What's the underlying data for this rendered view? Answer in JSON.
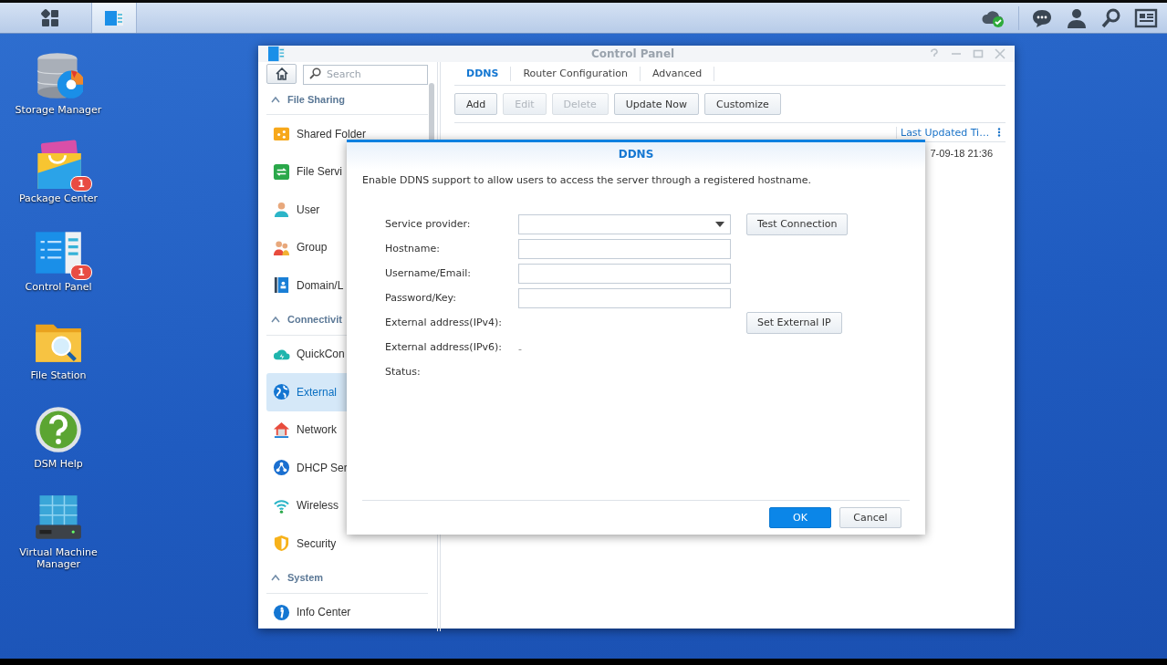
{
  "taskbar": {
    "apps": [
      {
        "kind": "main-menu",
        "selected": false
      },
      {
        "kind": "control-panel",
        "selected": true
      }
    ]
  },
  "desktop_icons": [
    {
      "kind": "storage",
      "label": "Storage Manager"
    },
    {
      "kind": "package",
      "label": "Package Center",
      "badge": "1"
    },
    {
      "kind": "control-panel",
      "label": "Control Panel",
      "badge": "1"
    },
    {
      "kind": "file-station",
      "label": "File Station"
    },
    {
      "kind": "help",
      "label": "DSM Help"
    },
    {
      "kind": "vm",
      "label": "Virtual Machine Manager"
    }
  ],
  "window": {
    "title": "Control Panel"
  },
  "sidebar": {
    "search": {
      "placeholder": "Search"
    },
    "sections": [
      {
        "title": "File Sharing",
        "expanded": true,
        "items": [
          {
            "kind": "shared-folder",
            "label": "Shared Folder",
            "selected": false
          },
          {
            "kind": "file-services",
            "label": "File Servi",
            "selected": false
          },
          {
            "kind": "user",
            "label": "User",
            "selected": false
          },
          {
            "kind": "group",
            "label": "Group",
            "selected": false
          },
          {
            "kind": "domain",
            "label": "Domain/L",
            "selected": false
          }
        ]
      },
      {
        "title": "Connectivit",
        "expanded": true,
        "items": [
          {
            "kind": "quickconnect",
            "label": "QuickCon",
            "selected": false
          },
          {
            "kind": "external",
            "label": "External",
            "selected": true
          },
          {
            "kind": "network",
            "label": "Network",
            "selected": false
          },
          {
            "kind": "dhcp",
            "label": "DHCP Ser",
            "selected": false
          },
          {
            "kind": "wireless",
            "label": "Wireless",
            "selected": false
          },
          {
            "kind": "security",
            "label": "Security",
            "selected": false
          }
        ]
      },
      {
        "title": "System",
        "expanded": true,
        "items": [
          {
            "kind": "info",
            "label": "Info Center",
            "selected": false
          }
        ]
      }
    ]
  },
  "tabs": [
    {
      "label": "DDNS",
      "selected": true
    },
    {
      "label": "Router Configuration",
      "selected": false
    },
    {
      "label": "Advanced",
      "selected": false
    }
  ],
  "toolbar": [
    {
      "label": "Add",
      "disabled": false
    },
    {
      "label": "Edit",
      "disabled": true
    },
    {
      "label": "Delete",
      "disabled": true
    },
    {
      "label": "Update Now",
      "disabled": false
    },
    {
      "label": "Customize",
      "disabled": false
    }
  ],
  "table": {
    "columns": [
      "Last Updated Ti…"
    ],
    "rows": [
      [
        "7-09-18 21:36"
      ]
    ]
  },
  "dialog": {
    "title": "DDNS",
    "description": "Enable DDNS support to allow users to access the server through a registered hostname.",
    "fields": [
      {
        "kind": "select",
        "label": "Service provider:",
        "button": "Test Connection"
      },
      {
        "kind": "text",
        "label": "Hostname:"
      },
      {
        "kind": "text",
        "label": "Username/Email:"
      },
      {
        "kind": "text",
        "label": "Password/Key:"
      },
      {
        "kind": "value",
        "label": "External address(IPv4):",
        "button": "Set External IP"
      },
      {
        "kind": "value",
        "label": "External address(IPv6):",
        "value": "-"
      },
      {
        "kind": "value",
        "label": "Status:"
      }
    ],
    "buttons": [
      {
        "label": "OK",
        "kind": "primary"
      },
      {
        "label": "Cancel",
        "kind": "default"
      }
    ]
  }
}
